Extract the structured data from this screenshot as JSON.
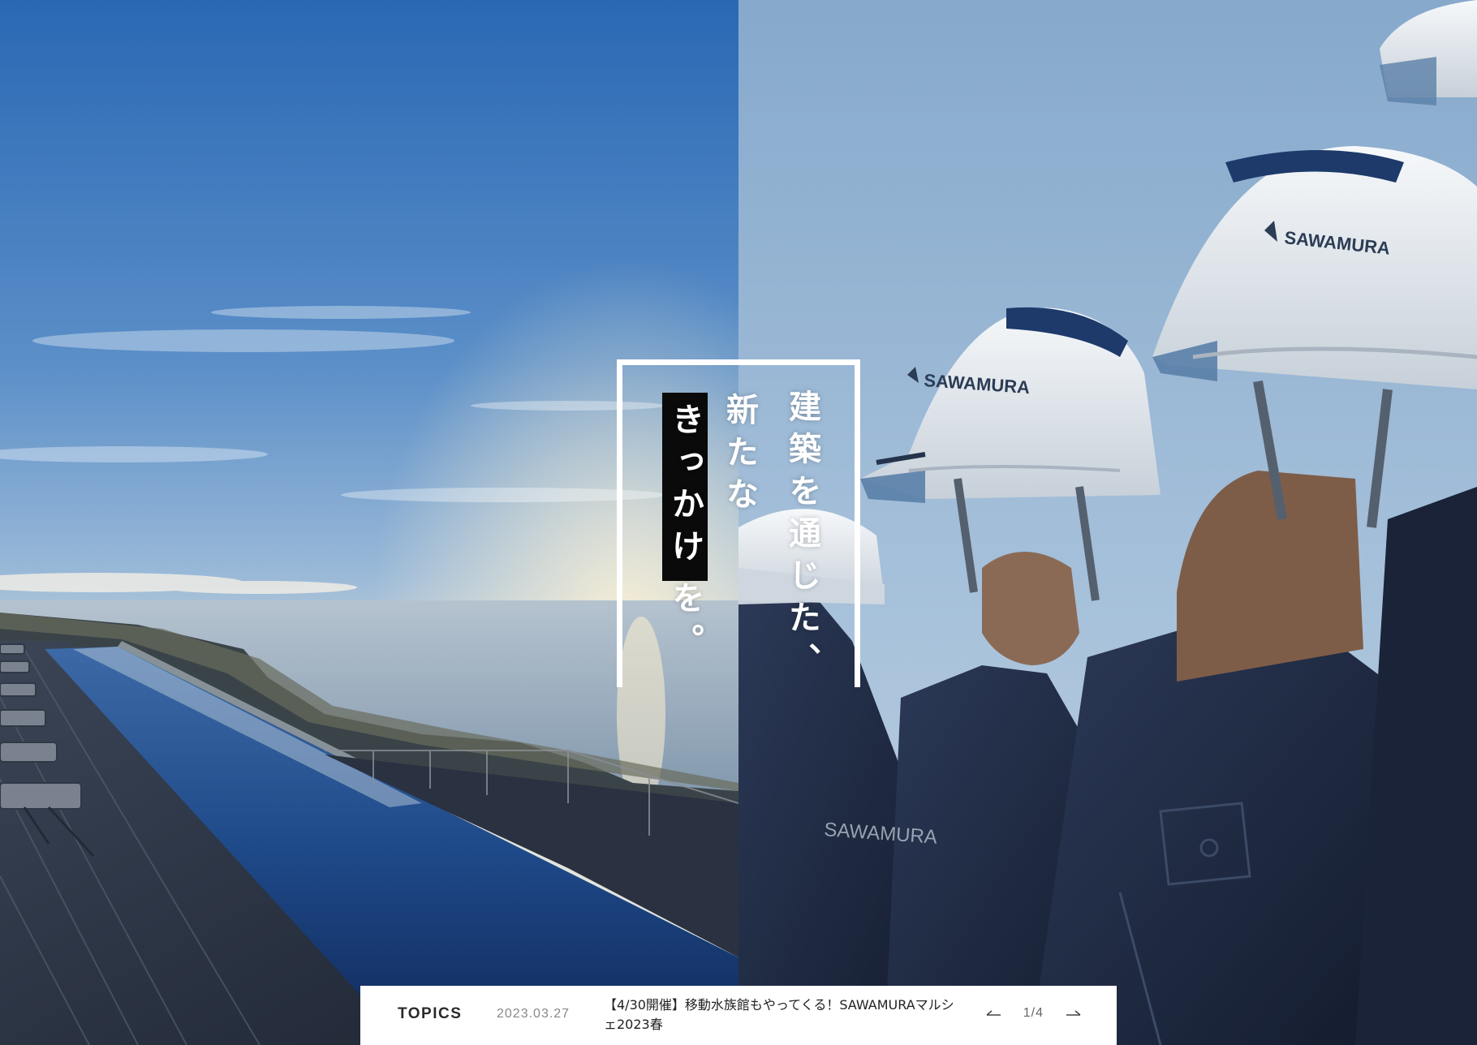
{
  "catchphrase": {
    "column1": "建築を通じた、",
    "column2": "新たな",
    "column3_highlight": "きっかけ",
    "column3_rest": "を。"
  },
  "helmet_logo_text": "SAWAMURA",
  "topics": {
    "label": "TOPICS",
    "date": "2023.03.27",
    "title": "【4/30開催】移動水族館もやってくる！SAWAMURAマルシェ2023春",
    "pager": "1/4"
  },
  "icons": {
    "prev": "arrow-left-icon",
    "next": "arrow-right-icon"
  },
  "colors": {
    "sky_top": "#2f6fb8",
    "sky_horizon": "#dfe4e4",
    "pool_water": "#1f4a8a",
    "uniform_navy": "#1c2740",
    "helmet_white": "#e9eef2",
    "highlight_black": "#0a0a0a",
    "bar_white": "#ffffff"
  }
}
